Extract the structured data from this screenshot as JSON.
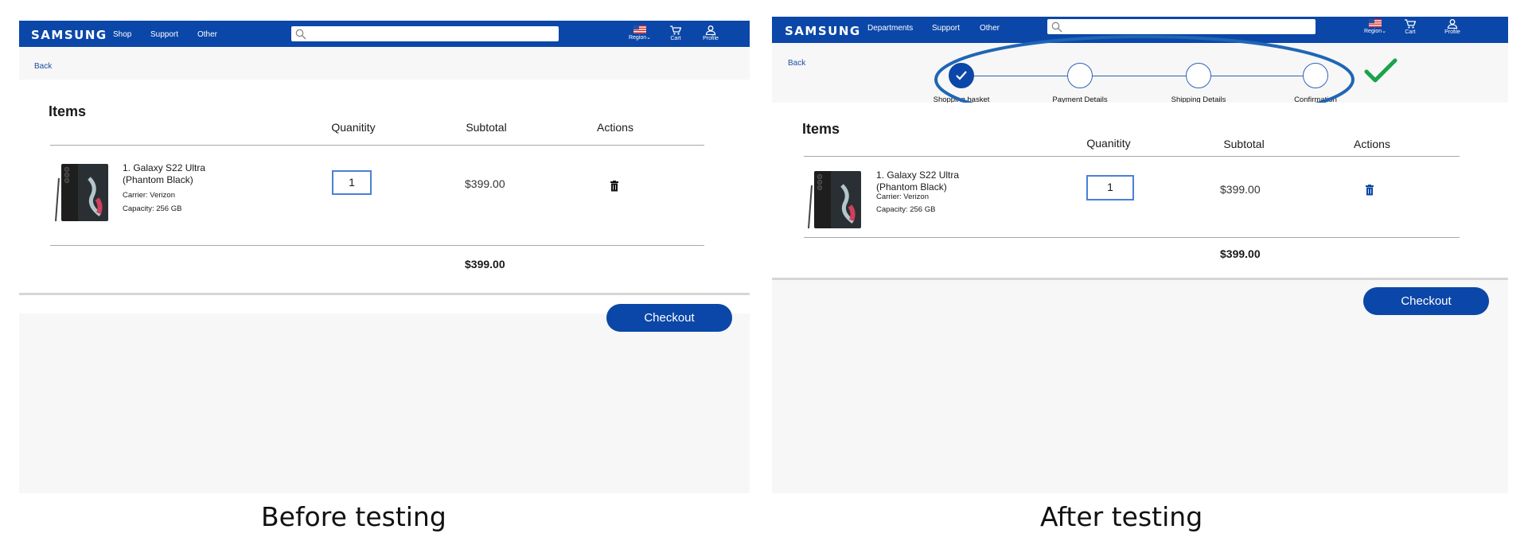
{
  "before": {
    "caption": "Before testing",
    "nav": {
      "logo": "SAMSUNG",
      "links": [
        "Shop",
        "Support",
        "Other"
      ],
      "search_placeholder": "",
      "icons": [
        {
          "icon": "flag-icon",
          "label": "Region"
        },
        {
          "icon": "cart-icon",
          "label": "Cart"
        },
        {
          "icon": "profile-icon",
          "label": "Profile"
        }
      ]
    },
    "back": "Back",
    "items_title": "Items",
    "columns": [
      "Quanitity",
      "Subtotal",
      "Actions"
    ],
    "item": {
      "name": "1. Galaxy S22 Ultra (Phantom Black)",
      "carrier": "Carrier: Verizon",
      "capacity": "Capacity: 256 GB",
      "quantity": "1",
      "subtotal": "$399.00"
    },
    "total": "$399.00",
    "checkout": "Checkout"
  },
  "after": {
    "caption": "After testing",
    "nav": {
      "logo": "SAMSUNG",
      "links": [
        "Departments",
        "Support",
        "Other"
      ],
      "search_placeholder": "",
      "icons": [
        {
          "icon": "flag-icon",
          "label": "Region"
        },
        {
          "icon": "cart-icon",
          "label": "Cart"
        },
        {
          "icon": "profile-icon",
          "label": "Profile"
        }
      ]
    },
    "back": "Back",
    "steps": [
      {
        "label": "Shopping basket",
        "done": true
      },
      {
        "label": "Payment Details",
        "done": false
      },
      {
        "label": "Shipping Details",
        "done": false
      },
      {
        "label": "Confirmation",
        "done": false
      }
    ],
    "items_title": "Items",
    "columns": [
      "Quanitity",
      "Subtotal",
      "Actions"
    ],
    "item": {
      "name": "1. Galaxy S22 Ultra (Phantom Black)",
      "carrier": "Carrier: Verizon",
      "capacity": "Capacity: 256 GB",
      "quantity": "1",
      "subtotal": "$399.00"
    },
    "total": "$399.00",
    "checkout": "Checkout"
  },
  "colors": {
    "brand_blue": "#0b47a8",
    "highlight_ellipse": "#1f66b5",
    "success_check": "#1aa34a"
  }
}
